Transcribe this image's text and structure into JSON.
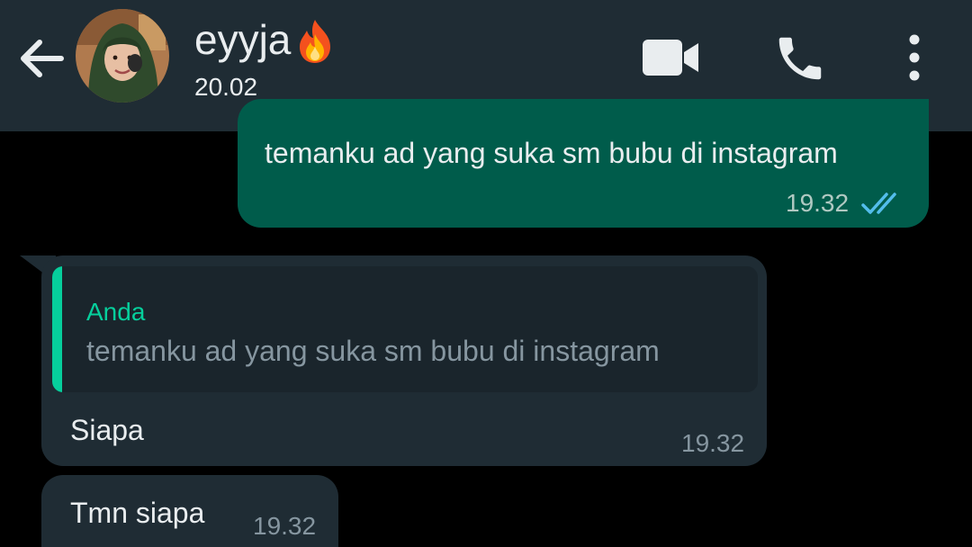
{
  "header": {
    "contact_name": "eyyja",
    "last_seen": "20.02",
    "icons": {
      "back": "arrow-left-icon",
      "avatar": "profile-photo",
      "emoji": "fire-emoji-icon",
      "video": "video-camera-icon",
      "call": "phone-icon",
      "menu": "vertical-dots-menu-icon"
    }
  },
  "messages": {
    "outgoing": {
      "text": "temanku ad yang suka sm bubu di instagram",
      "time": "19.32",
      "status_icon": "double-check-read-icon"
    },
    "incoming_reply": {
      "quoted_author": "Anda",
      "quoted_text": "temanku ad yang suka sm bubu di instagram",
      "text": "Siapa",
      "time": "19.32"
    },
    "incoming_second": {
      "text": "Tmn siapa",
      "time": "19.32"
    }
  },
  "colors": {
    "header_bg": "#1f2c34",
    "chat_bg": "#000000",
    "outgoing_bubble": "#005c4b",
    "incoming_bubble": "#1f2c34",
    "accent_green": "#06cf9c",
    "read_ticks": "#53bdeb",
    "primary_text": "#e9edef",
    "secondary_text": "#8696a0"
  }
}
